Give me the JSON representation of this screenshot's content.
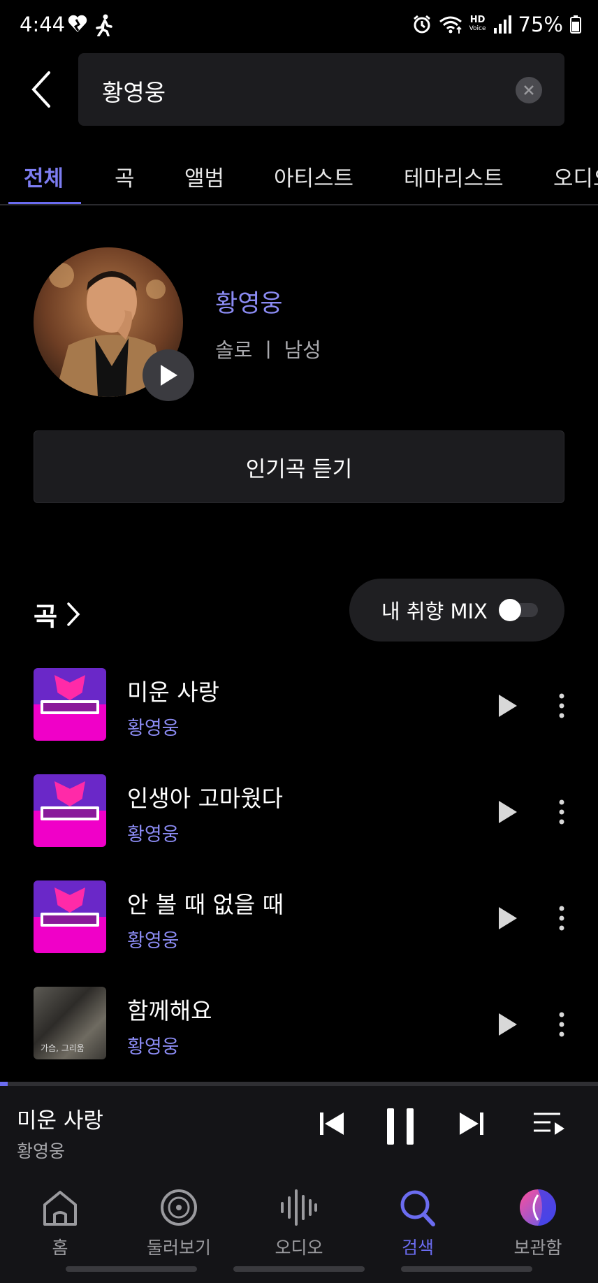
{
  "status_bar": {
    "time": "4:44",
    "battery_percent": "75%",
    "hd_label": "HD",
    "voice_label": "Voice",
    "icons": [
      "heart-icon",
      "walking-icon",
      "alarm-icon",
      "wifi-icon",
      "signal-icon",
      "battery-icon"
    ]
  },
  "search": {
    "query": "황영웅",
    "back_icon": "chevron-left-icon",
    "clear_icon": "close-icon"
  },
  "tabs": [
    {
      "label": "전체",
      "active": true
    },
    {
      "label": "곡",
      "active": false
    },
    {
      "label": "앨범",
      "active": false
    },
    {
      "label": "아티스트",
      "active": false
    },
    {
      "label": "테마리스트",
      "active": false
    },
    {
      "label": "오디오",
      "active": false
    }
  ],
  "artist": {
    "name": "황영웅",
    "meta": "솔로 ㅣ 남성",
    "popular_button": "인기곡 듣기"
  },
  "songs_section": {
    "title": "곡",
    "mix_label": "내 취향 MIX",
    "mix_enabled": false
  },
  "songs": [
    {
      "title": "미운 사랑",
      "artist": "황영웅",
      "cover": "magenta"
    },
    {
      "title": "인생아 고마웠다",
      "artist": "황영웅",
      "cover": "magenta"
    },
    {
      "title": "안 볼 때 없을 때",
      "artist": "황영웅",
      "cover": "magenta"
    },
    {
      "title": "함께해요",
      "artist": "황영웅",
      "cover": "photo",
      "cover_caption": "가슴, 그리움"
    }
  ],
  "mini_player": {
    "title": "미운 사랑",
    "artist": "황영웅",
    "progress": 0.013
  },
  "bottom_nav": [
    {
      "label": "홈",
      "icon": "home-icon",
      "active": false
    },
    {
      "label": "둘러보기",
      "icon": "disc-icon",
      "active": false
    },
    {
      "label": "오디오",
      "icon": "audio-wave-icon",
      "active": false
    },
    {
      "label": "검색",
      "icon": "search-icon",
      "active": true
    },
    {
      "label": "보관함",
      "icon": "library-icon",
      "active": false
    }
  ],
  "colors": {
    "accent": "#6b6cf0",
    "artist_text": "#8b8bf3",
    "background": "#000000",
    "surface": "#1c1c1f"
  }
}
